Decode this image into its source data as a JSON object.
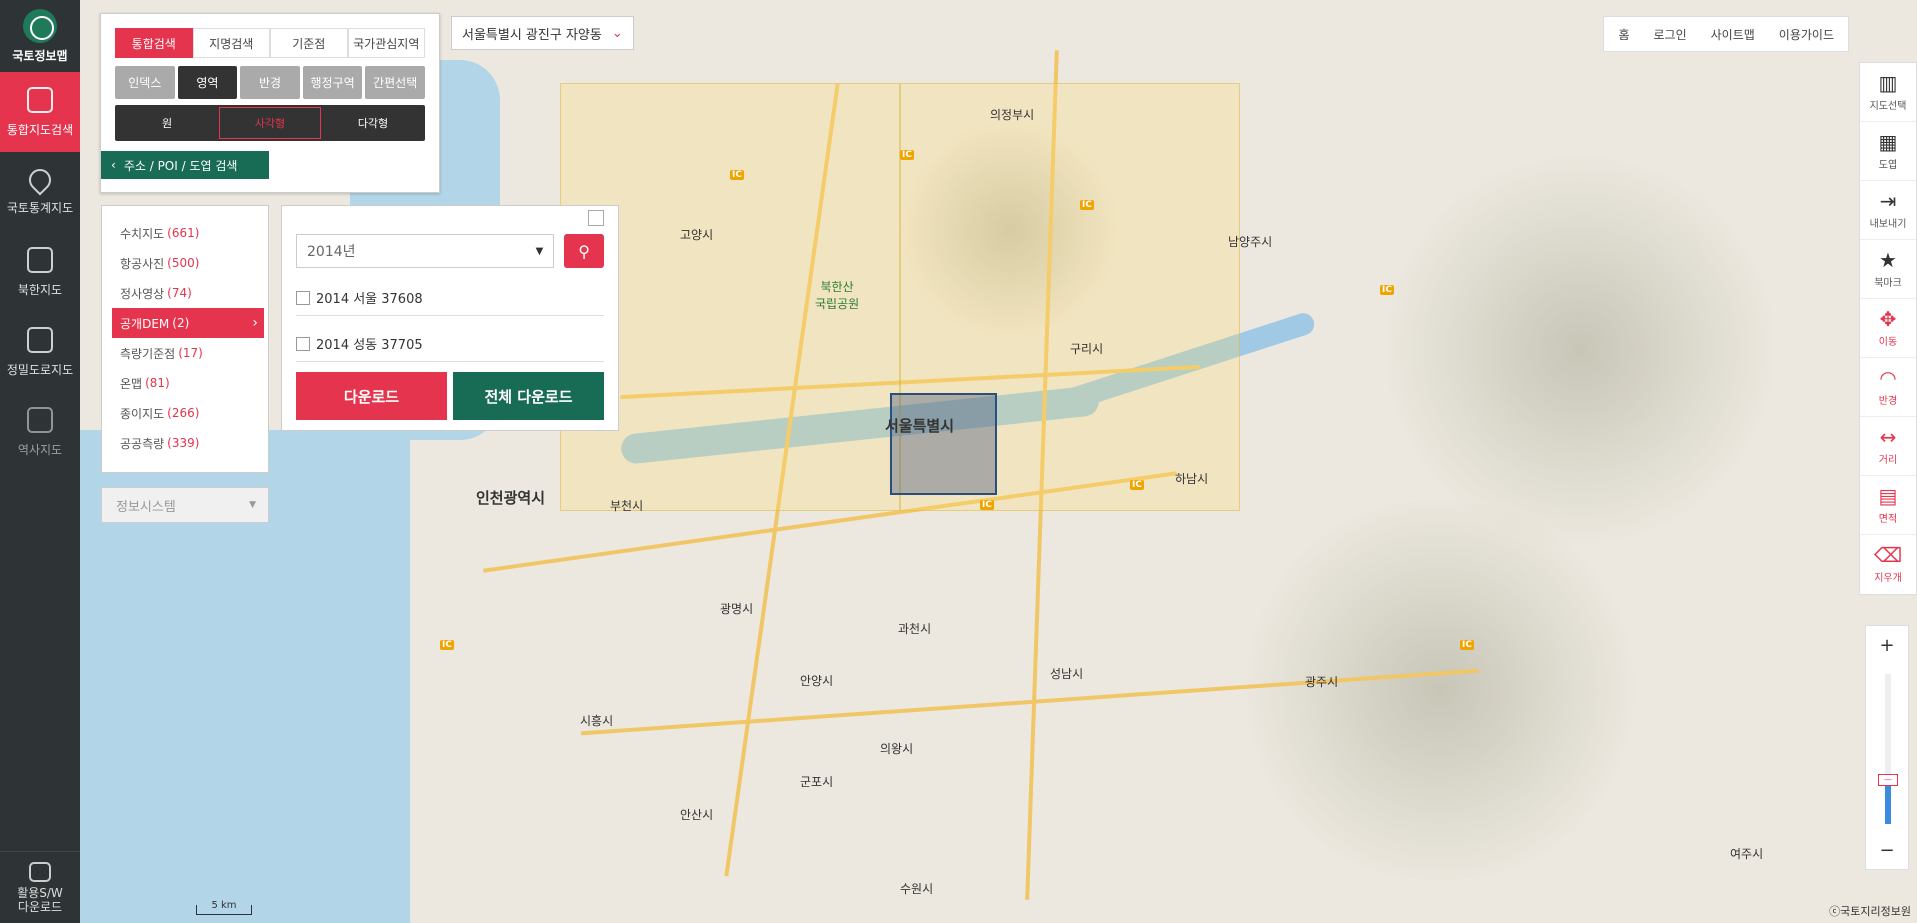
{
  "sidebar": {
    "logo": "국토정보맵",
    "items": [
      {
        "label": "통합지도검색"
      },
      {
        "label": "국토통계지도"
      },
      {
        "label": "북한지도"
      },
      {
        "label": "정밀도로지도"
      },
      {
        "label": "역사지도"
      }
    ],
    "bottom": "활용S/W\n다운로드"
  },
  "search": {
    "tabs": [
      "통합검색",
      "지명검색",
      "기준점",
      "국가관심지역"
    ],
    "modes": [
      "인덱스",
      "영역",
      "반경",
      "행정구역",
      "간편선택"
    ],
    "shapes": [
      "원",
      "사각형",
      "다각형"
    ],
    "address_btn": "주소 / POI / 도엽 검색"
  },
  "location": "서울특별시 광진구 자양동",
  "categories": [
    {
      "label": "수치지도",
      "count": "(661)"
    },
    {
      "label": "항공사진",
      "count": "(500)"
    },
    {
      "label": "정사영상",
      "count": "(74)"
    },
    {
      "label": "공개DEM",
      "count": "(2)"
    },
    {
      "label": "측량기준점",
      "count": "(17)"
    },
    {
      "label": "온맵",
      "count": "(81)"
    },
    {
      "label": "종이지도",
      "count": "(266)"
    },
    {
      "label": "공공측량",
      "count": "(339)"
    }
  ],
  "info_system": "정보시스템",
  "detail": {
    "year": "2014년",
    "items": [
      "2014 서울 37608",
      "2014 성동 37705"
    ],
    "download": "다운로드",
    "download_all": "전체 다운로드"
  },
  "top_links": [
    "홈",
    "로그인",
    "사이트맵",
    "이용가이드"
  ],
  "tools": [
    {
      "label": "지도선택",
      "glyph": "▥"
    },
    {
      "label": "도엽",
      "glyph": "▦"
    },
    {
      "label": "내보내기",
      "glyph": "⇥"
    },
    {
      "label": "북마크",
      "glyph": "★"
    },
    {
      "label": "이동",
      "glyph": "✥"
    },
    {
      "label": "반경",
      "glyph": "◠"
    },
    {
      "label": "거리",
      "glyph": "↔"
    },
    {
      "label": "면적",
      "glyph": "▤"
    },
    {
      "label": "지우개",
      "glyph": "⌫"
    }
  ],
  "zoom": {
    "plus": "+",
    "minus": "−"
  },
  "map_labels": {
    "seoul": "서울특별시",
    "incheon": "인천광역시",
    "uijeongbu": "의정부시",
    "namyangju": "남양주시",
    "guri": "구리시",
    "hanam": "하남시",
    "seongnam": "성남시",
    "gwangmyeong": "광명시",
    "anyang": "안양시",
    "gwacheon": "과천시",
    "siheung": "시흥시",
    "ansan": "안산시",
    "suwon": "수원시",
    "gunpo": "군포시",
    "uiwang": "의왕시",
    "bucheon": "부천시",
    "goyang": "고양시",
    "gwangju": "광주시",
    "yeoju": "여주시",
    "bukhansan": "북한산\n국립공원",
    "scale": "5 km",
    "copyright": "ⓒ국토지리정보원"
  }
}
